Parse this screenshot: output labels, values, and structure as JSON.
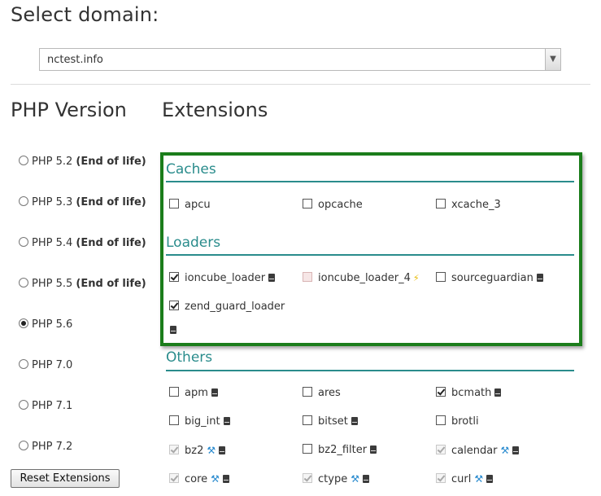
{
  "header": {
    "title": "Select domain:"
  },
  "domain_select": {
    "value": "nctest.info"
  },
  "php_section": {
    "title": "PHP Version"
  },
  "extensions_section": {
    "title": "Extensions"
  },
  "php_versions": [
    {
      "label": "PHP 5.2",
      "note": "(End of life)",
      "selected": false
    },
    {
      "label": "PHP 5.3",
      "note": "(End of life)",
      "selected": false
    },
    {
      "label": "PHP 5.4",
      "note": "(End of life)",
      "selected": false
    },
    {
      "label": "PHP 5.5",
      "note": "(End of life)",
      "selected": false
    },
    {
      "label": "PHP 5.6",
      "note": "",
      "selected": true
    },
    {
      "label": "PHP 7.0",
      "note": "",
      "selected": false
    },
    {
      "label": "PHP 7.1",
      "note": "",
      "selected": false
    },
    {
      "label": "PHP 7.2",
      "note": "",
      "selected": false
    }
  ],
  "reset_button": {
    "label": "Reset Extensions"
  },
  "groups": {
    "caches": {
      "title": "Caches",
      "items": [
        {
          "name": "apcu",
          "checked": false
        },
        {
          "name": "opcache",
          "checked": false
        },
        {
          "name": "xcache_3",
          "checked": false
        }
      ]
    },
    "loaders": {
      "title": "Loaders",
      "items": [
        {
          "name": "ioncube_loader",
          "checked": true,
          "icon": "doc-icon"
        },
        {
          "name": "ioncube_loader_4",
          "checked": false,
          "conflict": true,
          "icon": "bolt-icon"
        },
        {
          "name": "sourceguardian",
          "checked": false,
          "icon": "doc-icon"
        },
        {
          "name": "zend_guard_loader",
          "checked": true,
          "icon": "doc-icon"
        }
      ]
    },
    "others": {
      "title": "Others",
      "items": [
        {
          "name": "apm",
          "checked": false,
          "icon": "doc-icon"
        },
        {
          "name": "ares",
          "checked": false
        },
        {
          "name": "bcmath",
          "checked": true,
          "icon": "doc-icon"
        },
        {
          "name": "big_int",
          "checked": false,
          "icon": "doc-icon"
        },
        {
          "name": "bitset",
          "checked": false,
          "icon": "doc-icon"
        },
        {
          "name": "brotli",
          "checked": false
        },
        {
          "name": "bz2",
          "checked": true,
          "disabled": true,
          "icons": [
            "wrench-icon",
            "doc-icon"
          ]
        },
        {
          "name": "bz2_filter",
          "checked": false,
          "icon": "doc-icon"
        },
        {
          "name": "calendar",
          "checked": true,
          "disabled": true,
          "icons": [
            "wrench-icon",
            "doc-icon"
          ]
        },
        {
          "name": "core",
          "checked": true,
          "disabled": true,
          "icons": [
            "wrench-icon",
            "doc-icon"
          ]
        },
        {
          "name": "ctype",
          "checked": true,
          "disabled": true,
          "icons": [
            "wrench-icon",
            "doc-icon"
          ]
        },
        {
          "name": "curl",
          "checked": true,
          "disabled": true,
          "icons": [
            "wrench-icon",
            "doc-icon"
          ]
        }
      ]
    }
  },
  "colors": {
    "section": "#2a8c8c",
    "highlight_border": "#1b7d1b",
    "wrench": "#2a8bcf"
  }
}
